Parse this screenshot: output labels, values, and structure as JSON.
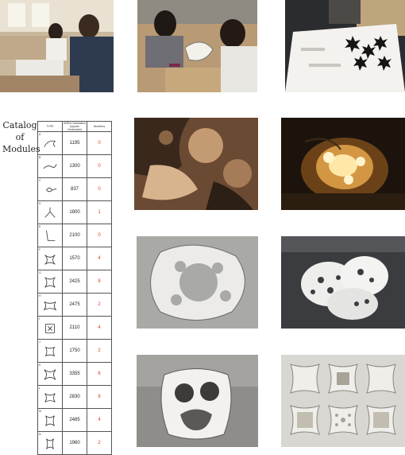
{
  "catalog": {
    "title_lines": [
      "Catalog",
      "of",
      "Modules"
    ],
    "headers": {
      "type": "TYPE",
      "area": "AREA Calculation",
      "area_sub": "(square Centimeter)",
      "numbers": "Numbers"
    },
    "rows": [
      {
        "type": "A",
        "area": "1195",
        "count": "0"
      },
      {
        "type": "B",
        "area": "1300",
        "count": "0"
      },
      {
        "type": "C",
        "area": "837",
        "count": "0"
      },
      {
        "type": "D",
        "area": "1800",
        "count": "1"
      },
      {
        "type": "E",
        "area": "2100",
        "count": "0"
      },
      {
        "type": "F",
        "area": "1570",
        "count": "4"
      },
      {
        "type": "G",
        "area": "2425",
        "count": "8"
      },
      {
        "type": "H",
        "area": "2475",
        "count": "2"
      },
      {
        "type": "I",
        "area": "2110",
        "count": "4"
      },
      {
        "type": "J",
        "area": "1750",
        "count": "2"
      },
      {
        "type": "K",
        "area": "3355",
        "count": "6"
      },
      {
        "type": "L",
        "area": "2830",
        "count": "8"
      },
      {
        "type": "M",
        "area": "2485",
        "count": "4"
      },
      {
        "type": "N",
        "area": "1960",
        "count": "2"
      }
    ]
  },
  "colors": {
    "count_text": "#e03a2a",
    "table_border": "#555555"
  },
  "photos": [
    {
      "id": "workshop-group",
      "subject": "workshop participants at tables"
    },
    {
      "id": "workshop-assembly",
      "subject": "two people assembling paper modules"
    },
    {
      "id": "laser-cutter",
      "subject": "laser cutter with cut star shapes"
    },
    {
      "id": "closeup-shadows",
      "subject": "warm close-up of module shadows"
    },
    {
      "id": "lit-lamp",
      "subject": "illuminated module lamp"
    },
    {
      "id": "white-ring",
      "subject": "white ring module on grey"
    },
    {
      "id": "stacked-modules",
      "subject": "stacked perforated modules"
    },
    {
      "id": "single-module",
      "subject": "single module close-up"
    },
    {
      "id": "module-grid",
      "subject": "six flat module samples"
    }
  ]
}
